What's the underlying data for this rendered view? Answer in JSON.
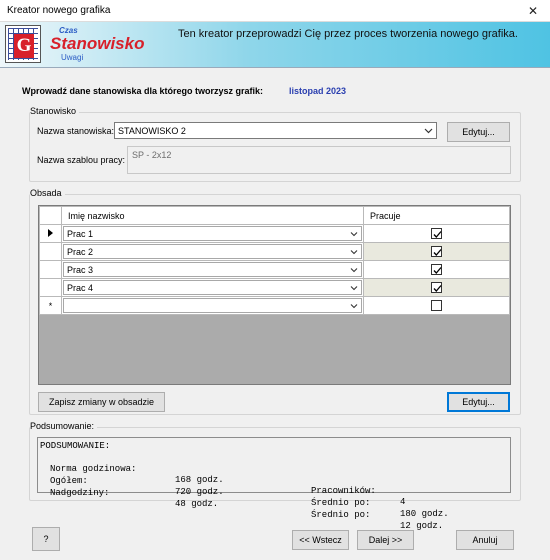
{
  "window": {
    "title": "Kreator nowego grafika",
    "close_glyph": "✕"
  },
  "banner": {
    "brand_top": "Czas",
    "brand_main": "Stanowisko",
    "brand_bottom": "Uwagi",
    "logo_letter": "G",
    "description": "Ten kreator przeprowadzi Cię przez proces tworzenia nowego grafika."
  },
  "prompt": {
    "label": "Wprowadź dane stanowiska dla którego tworzysz grafik:",
    "period": "listopad 2023"
  },
  "stanowisko": {
    "group_label": "Stanowisko",
    "name_label": "Nazwa stanowiska:",
    "name_value": "STANOWISKO 2",
    "edit_button": "Edytuj...",
    "template_label": "Nazwa szablou pracy:",
    "template_value": "SP - 2x12"
  },
  "obsada": {
    "group_label": "Obsada",
    "columns": {
      "name": "Imię nazwisko",
      "works": "Pracuje"
    },
    "rows": [
      {
        "name": "Prac 1",
        "works": true
      },
      {
        "name": "Prac 2",
        "works": true
      },
      {
        "name": "Prac 3",
        "works": true
      },
      {
        "name": "Prac 4",
        "works": true
      },
      {
        "name": "",
        "works": false
      }
    ],
    "current_row_marker": "▶",
    "new_row_marker": "*",
    "save_button": "Zapisz zmiany w obsadzie",
    "edit_button": "Edytuj..."
  },
  "podsumowanie": {
    "group_label": "Podsumowanie:",
    "heading": "PODSUMOWANIE:",
    "rows": [
      {
        "l1": "Norma godzinowa:",
        "v1": "168 godz.",
        "l2": "Pracowników:",
        "v2": "4"
      },
      {
        "l1": "Ogółem:",
        "v1": "720 godz.",
        "l2": "Średnio po:",
        "v2": "180 godz."
      },
      {
        "l1": "Nadgodziny:",
        "v1": "48 godz.",
        "l2": "Średnio po:",
        "v2": "12 godz."
      }
    ]
  },
  "footer": {
    "help": "?",
    "back": "<< Wstecz",
    "next": "Dalej >>",
    "cancel": "Anuluj"
  }
}
